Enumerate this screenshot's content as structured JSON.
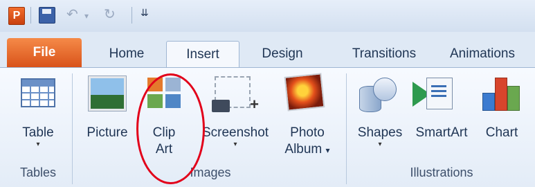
{
  "quick_access": {
    "app_icon": "powerpoint-icon",
    "app_letter": "P",
    "undo_glyph": "↶",
    "redo_glyph": "↻",
    "customize_glyph": "⇊",
    "icons": [
      "powerpoint-icon",
      "save-icon",
      "undo-icon",
      "redo-icon",
      "customize-toolbar-icon"
    ]
  },
  "tabs": [
    {
      "label": "File"
    },
    {
      "label": "Home"
    },
    {
      "label": "Insert"
    },
    {
      "label": "Design"
    },
    {
      "label": "Transitions"
    },
    {
      "label": "Animations"
    }
  ],
  "active_tab": "Insert",
  "ribbon": {
    "groups": [
      {
        "label": "Tables",
        "buttons": [
          {
            "line1": "Table",
            "line2": "",
            "has_dropdown": true,
            "icon": "table-icon"
          }
        ]
      },
      {
        "label": "Images",
        "buttons": [
          {
            "line1": "Picture",
            "line2": "",
            "has_dropdown": false,
            "icon": "picture-icon"
          },
          {
            "line1": "Clip",
            "line2": "Art",
            "has_dropdown": false,
            "icon": "clip-art-icon"
          },
          {
            "line1": "Screenshot",
            "line2": "",
            "has_dropdown": true,
            "icon": "screenshot-icon"
          },
          {
            "line1": "Photo",
            "line2": "Album",
            "has_dropdown": true,
            "icon": "photo-album-icon"
          }
        ]
      },
      {
        "label": "Illustrations",
        "buttons": [
          {
            "line1": "Shapes",
            "line2": "",
            "has_dropdown": true,
            "icon": "shapes-icon"
          },
          {
            "line1": "SmartArt",
            "line2": "",
            "has_dropdown": false,
            "icon": "smartart-icon"
          },
          {
            "line1": "Chart",
            "line2": "",
            "has_dropdown": false,
            "icon": "chart-icon"
          }
        ]
      }
    ]
  },
  "dropdown_glyph": "▾",
  "annotation": {
    "shape": "ellipse",
    "color": "#e2001a",
    "target": "Clip Art"
  },
  "colors": {
    "file_tab": "#e0632a",
    "ribbon_bg": "#eef3fa",
    "text": "#1f3554",
    "highlight": "#e2001a"
  }
}
